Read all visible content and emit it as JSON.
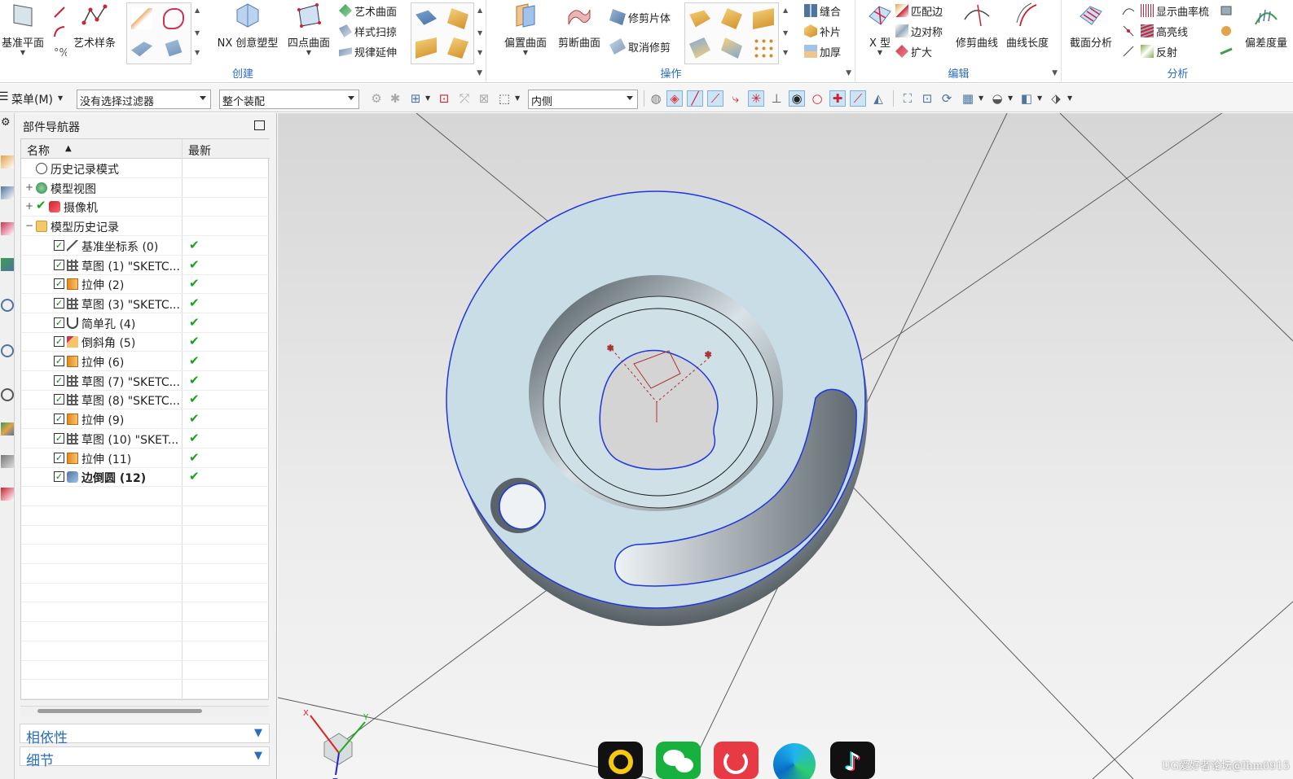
{
  "ribbon": {
    "create": {
      "title": "创建",
      "datum_plane": "基准平面",
      "studio_spline": "艺术样条",
      "nx_realize": "NX 创意塑型",
      "four_point": "四点曲面",
      "studio_surface": "艺术曲面",
      "styled_sweep": "样式扫掠",
      "ruled_extend": "规律延伸"
    },
    "operation": {
      "title": "操作",
      "offset_surface": "偏置曲面",
      "trim_sheet": "剪断曲面",
      "trim_body": "修剪片体",
      "untrim": "取消修剪",
      "sew": "缝合",
      "patch": "补片",
      "thicken": "加厚"
    },
    "edit": {
      "title": "编辑",
      "x_form": "X 型",
      "match_edge": "匹配边",
      "edge_symmetry": "边对称",
      "enlarge": "扩大",
      "trim_curve": "修剪曲线",
      "curve_length": "曲线长度"
    },
    "analysis": {
      "title": "分析",
      "section_analysis": "截面分析",
      "show_curvature_comb": "显示曲率梳",
      "highlight_lines": "高亮线",
      "reflection": "反射",
      "deviation": "偏差度量"
    }
  },
  "toolbar": {
    "menu": "菜单(M)",
    "filter": "没有选择过滤器",
    "assembly_scope": "整个装配",
    "snap_mode": "内侧"
  },
  "navigator": {
    "title": "部件导航器",
    "col_name": "名称",
    "col_latest": "最新",
    "rows": [
      {
        "label": "历史记录模式"
      },
      {
        "label": "模型视图"
      },
      {
        "label": "摄像机"
      },
      {
        "label": "模型历史记录"
      },
      {
        "label": "基准坐标系 (0)"
      },
      {
        "label": "草图 (1) \"SKETC..."
      },
      {
        "label": "拉伸 (2)"
      },
      {
        "label": "草图 (3) \"SKETC..."
      },
      {
        "label": "简单孔 (4)"
      },
      {
        "label": "倒斜角 (5)"
      },
      {
        "label": "拉伸 (6)"
      },
      {
        "label": "草图 (7) \"SKETC..."
      },
      {
        "label": "草图 (8) \"SKETC..."
      },
      {
        "label": "拉伸 (9)"
      },
      {
        "label": "草图 (10) \"SKET..."
      },
      {
        "label": "拉伸 (11)"
      },
      {
        "label": "边倒圆 (12)"
      }
    ],
    "sections": {
      "dependencies": "相依性",
      "details": "细节"
    }
  },
  "viewport": {
    "triad": {
      "x": "X",
      "y": "Y",
      "z": "Z"
    },
    "watermark": "UG爱好者论坛@lhm0915"
  },
  "colors": {
    "accent": "#2a6ebb",
    "part_face": "#c9dde6",
    "part_side": "#5f686d",
    "edge_highlight": "#1f35e0",
    "check_green": "#17a317"
  }
}
